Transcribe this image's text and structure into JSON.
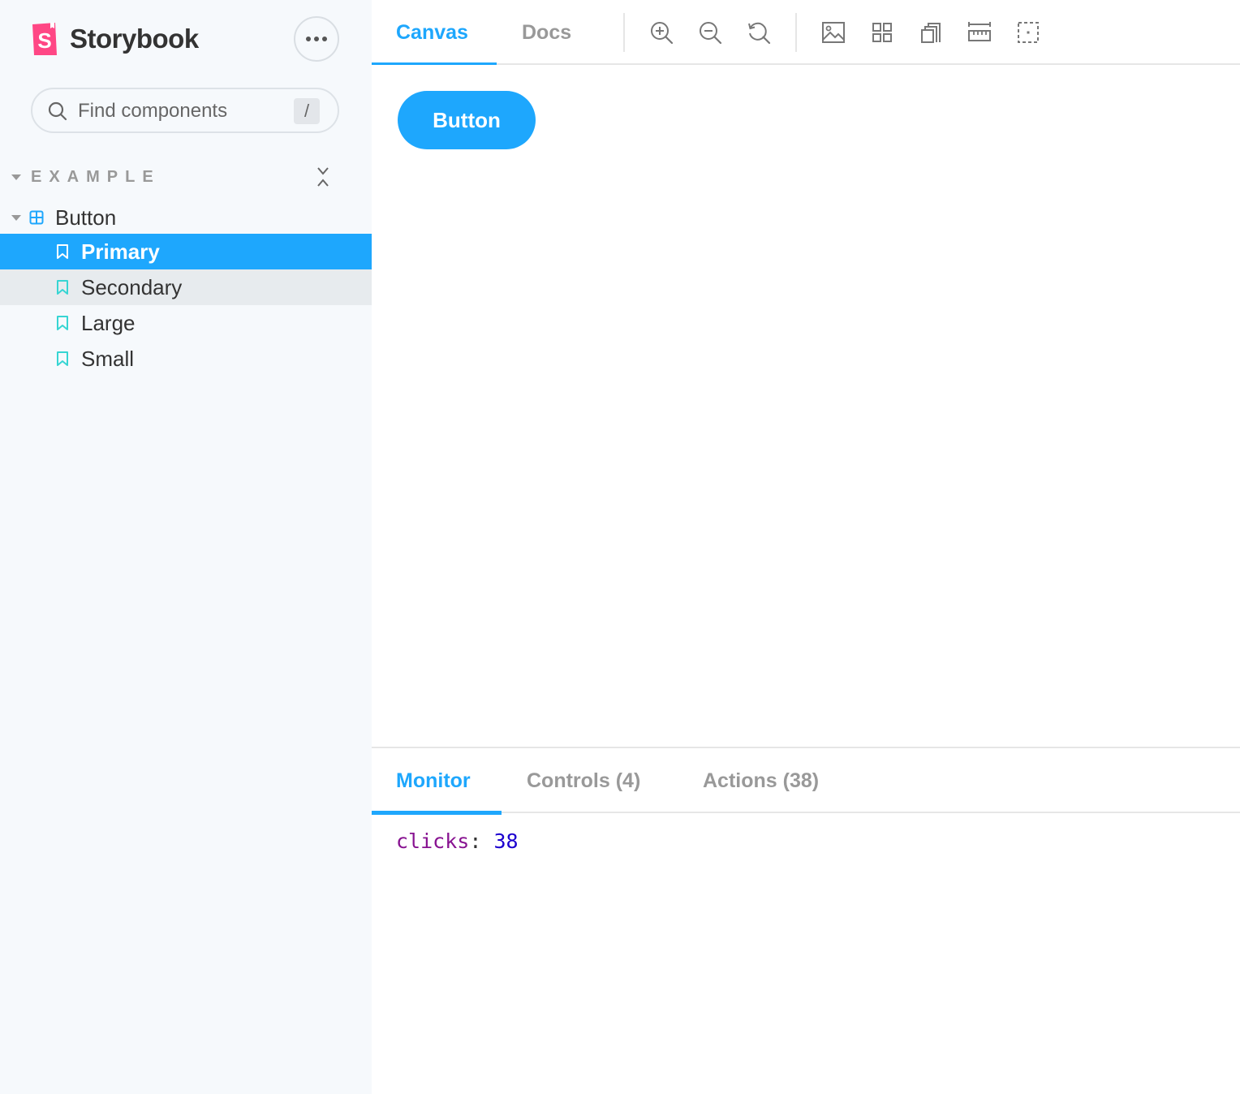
{
  "sidebar": {
    "brand": "Storybook",
    "search": {
      "placeholder": "Find components",
      "shortcut": "/"
    },
    "group": {
      "label": "EXAMPLE"
    },
    "component": {
      "label": "Button"
    },
    "stories": [
      {
        "label": "Primary",
        "state": "selected"
      },
      {
        "label": "Secondary",
        "state": "hover"
      },
      {
        "label": "Large",
        "state": ""
      },
      {
        "label": "Small",
        "state": ""
      }
    ]
  },
  "toolbar": {
    "tabs": [
      {
        "label": "Canvas",
        "active": true
      },
      {
        "label": "Docs",
        "active": false
      }
    ],
    "tools": [
      "zoom-in-icon",
      "zoom-out-icon",
      "zoom-reset-icon",
      "background-icon",
      "grid-icon",
      "viewport-icon",
      "measure-icon",
      "outline-icon"
    ]
  },
  "canvas": {
    "button_label": "Button"
  },
  "panel": {
    "tabs": [
      {
        "label": "Monitor",
        "active": true
      },
      {
        "label": "Controls (4)",
        "active": false
      },
      {
        "label": "Actions (38)",
        "active": false
      }
    ],
    "monitor": {
      "key": "clicks",
      "separator": ":",
      "value": "38"
    }
  },
  "colors": {
    "accent": "#1ea7fd",
    "brand_pink": "#ff4785",
    "story_icon": "#37d5d3",
    "sidebar_bg": "#f6f9fc"
  }
}
